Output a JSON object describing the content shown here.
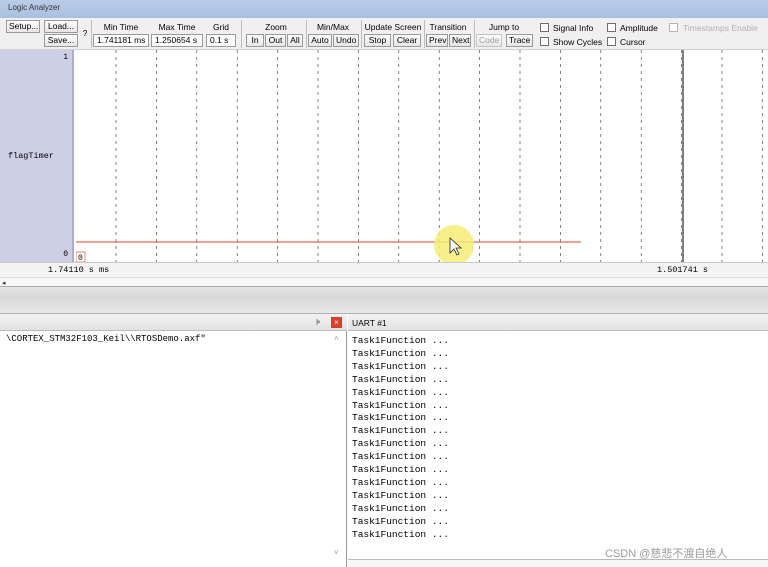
{
  "window": {
    "title": "Logic Analyzer"
  },
  "toolbar": {
    "setup": "Setup...",
    "load": "Load...",
    "save": "Save...",
    "help": "?",
    "min_time_label": "Min Time",
    "min_time_value": "1.741181 ms",
    "max_time_label": "Max Time",
    "max_time_value": "1.250654 s",
    "grid_label": "Grid",
    "grid_value": "0.1 s",
    "zoom_label": "Zoom",
    "zoom_in": "In",
    "zoom_out": "Out",
    "zoom_all": "All",
    "minmax_label": "Min/Max",
    "auto": "Auto",
    "undo": "Undo",
    "update_label": "Update Screen",
    "stop": "Stop",
    "clear": "Clear",
    "transition_label": "Transition",
    "prev": "Prev",
    "next": "Next",
    "jump_label": "Jump to",
    "code": "Code",
    "trace": "Trace",
    "signal_info": "Signal Info",
    "show_cycles": "Show Cycles",
    "amplitude": "Amplitude",
    "cursor": "Cursor",
    "timestamps": "Timestamps Enable"
  },
  "plot": {
    "signal": "flagTimer",
    "y_max": "1",
    "y_min": "0",
    "t_left": "1.74110 s ms",
    "t_right": "1.501741  s",
    "origin_marker": "0",
    "trace_color": "#e06a55",
    "grid_color": "#333333"
  },
  "command_pane": {
    "line": "\\CORTEX_STM32F103_Keil\\\\RTOSDemo.axf\""
  },
  "uart_pane": {
    "title": "UART #1",
    "lines": [
      "Task1Function ...",
      "Task1Function ...",
      "Task1Function ...",
      "Task1Function ...",
      "Task1Function ...",
      "Task1Function ...",
      "Task1Function ...",
      "Task1Function ...",
      "Task1Function ...",
      "Task1Function ...",
      "Task1Function ...",
      "Task1Function ...",
      "Task1Function ...",
      "Task1Function ...",
      "Task1Function ...",
      "Task1Function ..."
    ]
  },
  "watermark": "CSDN @慈悲不渡自绝人"
}
